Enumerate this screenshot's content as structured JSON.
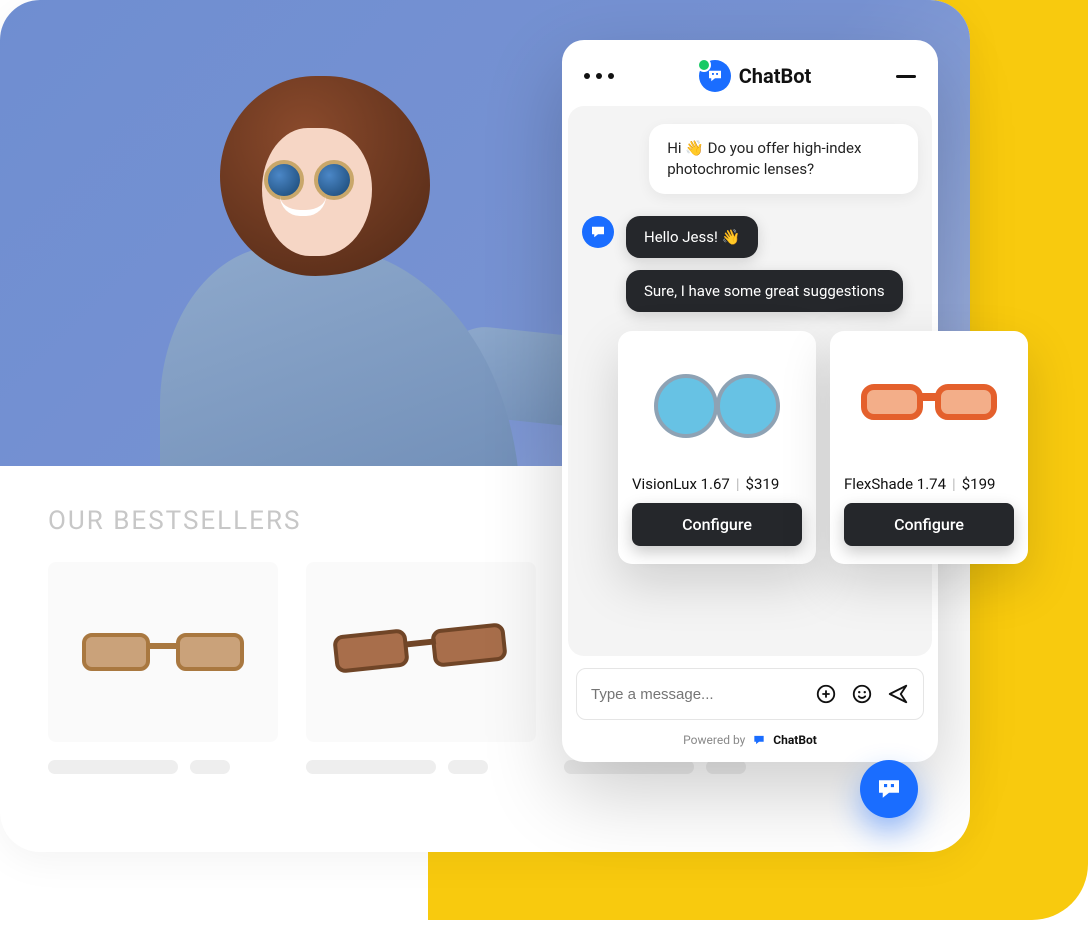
{
  "site": {
    "bestsellers_title": "OUR BESTSELLERS"
  },
  "chat": {
    "brand": "ChatBot",
    "user_msg": "Hi 👋 Do you offer high-index photochromic lenses?",
    "bot_msg1": "Hello Jess! 👋",
    "bot_msg2": "Sure, I have some great suggestions",
    "input_placeholder": "Type a message...",
    "powered_prefix": "Powered by",
    "powered_brand": "ChatBot"
  },
  "products": [
    {
      "name": "VisionLux 1.67",
      "price": "$319",
      "cta": "Configure"
    },
    {
      "name": "FlexShade 1.74",
      "price": "$199",
      "cta": "Configure"
    }
  ]
}
